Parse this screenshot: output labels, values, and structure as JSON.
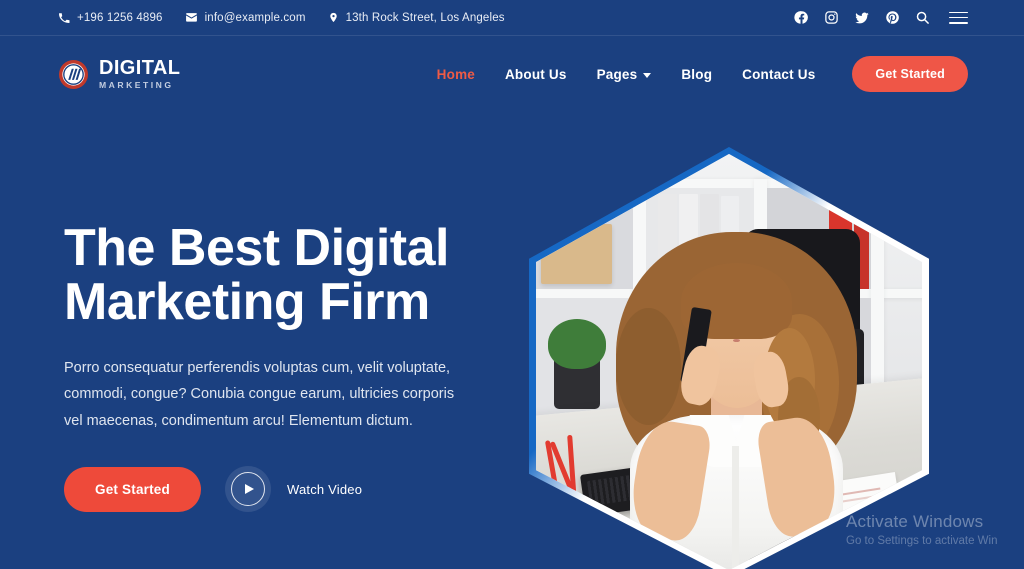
{
  "topbar": {
    "phone": {
      "icon": "phone-icon",
      "text": "+196 1256 4896"
    },
    "email": {
      "icon": "envelope-icon",
      "text": "info@example.com"
    },
    "address": {
      "icon": "map-pin-icon",
      "text": "13th Rock Street, Los Angeles"
    },
    "social": [
      {
        "icon": "facebook-icon",
        "name": "Facebook"
      },
      {
        "icon": "instagram-icon",
        "name": "Instagram"
      },
      {
        "icon": "twitter-icon",
        "name": "Twitter"
      },
      {
        "icon": "pinterest-icon",
        "name": "Pinterest"
      }
    ],
    "search_icon": "search-icon",
    "menu_icon": "hamburger-menu-icon"
  },
  "brand": {
    "title": "DIGITAL",
    "subtitle": "MARKETING",
    "mark": "circular-striped-logo-icon"
  },
  "nav": {
    "items": [
      {
        "label": "Home",
        "active": true,
        "dropdown": false
      },
      {
        "label": "About Us",
        "active": false,
        "dropdown": false
      },
      {
        "label": "Pages",
        "active": false,
        "dropdown": true
      },
      {
        "label": "Blog",
        "active": false,
        "dropdown": false
      },
      {
        "label": "Contact Us",
        "active": false,
        "dropdown": false
      }
    ],
    "cta_label": "Get Started"
  },
  "hero": {
    "title_line1": "The Best Digital",
    "title_line2": "Marketing Firm",
    "description": "Porro consequatur perferendis voluptas cum, velit voluptate, commodi, congue? Conubia congue earum, ultricies corporis vel maecenas, condimentum arcu! Elementum dictum.",
    "primary_button": "Get Started",
    "video_label": "Watch Video",
    "image_alt": "Woman in white blouse talking on phone at an office desk with keyboard and calculator"
  },
  "watermark": {
    "title": "Activate Windows",
    "subtitle": "Go to Settings to activate Win"
  },
  "colors": {
    "background_blue": "#1b4080",
    "accent_coral": "#ef5b45",
    "hero_button_red": "#ee4a3a",
    "hex_border_blue": "#1668c4",
    "hex_border_white": "#ffffff",
    "text_white": "#ffffff",
    "text_muted": "#dfe5ef"
  }
}
